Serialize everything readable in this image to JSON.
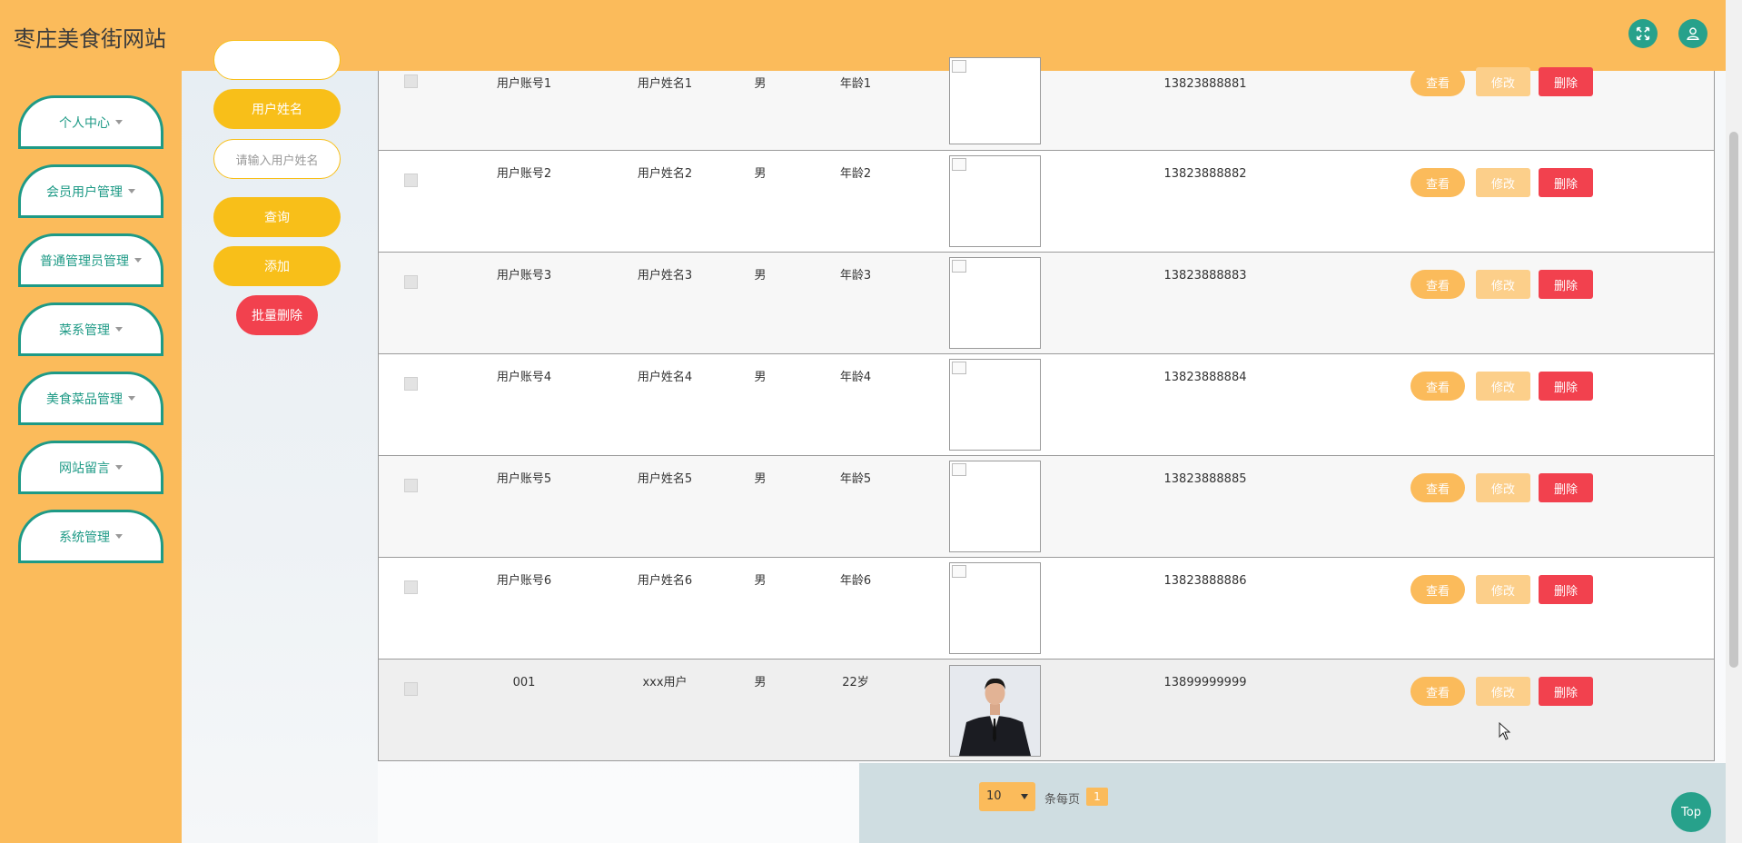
{
  "header": {
    "title": "枣庄美食街网站",
    "icons": [
      "fullscreen-icon",
      "user-icon"
    ],
    "accent": "#fbbb5b",
    "teal": "#27a18b"
  },
  "sidebar": {
    "items": [
      {
        "label": "个人中心"
      },
      {
        "label": "会员用户管理"
      },
      {
        "label": "普通管理员管理"
      },
      {
        "label": "菜系管理"
      },
      {
        "label": "美食菜品管理"
      },
      {
        "label": "网站留言"
      },
      {
        "label": "系统管理"
      }
    ]
  },
  "search": {
    "field_label": "用户姓名",
    "input_placeholder": "请输入用户姓名",
    "query_button": "查询",
    "add_button": "添加",
    "batch_delete_button": "批量删除"
  },
  "table": {
    "rows": [
      {
        "account": "用户账号1",
        "name": "用户姓名1",
        "gender": "男",
        "age": "年龄1",
        "phone": "13823888881",
        "has_photo": false
      },
      {
        "account": "用户账号2",
        "name": "用户姓名2",
        "gender": "男",
        "age": "年龄2",
        "phone": "13823888882",
        "has_photo": false
      },
      {
        "account": "用户账号3",
        "name": "用户姓名3",
        "gender": "男",
        "age": "年龄3",
        "phone": "13823888883",
        "has_photo": false
      },
      {
        "account": "用户账号4",
        "name": "用户姓名4",
        "gender": "男",
        "age": "年龄4",
        "phone": "13823888884",
        "has_photo": false
      },
      {
        "account": "用户账号5",
        "name": "用户姓名5",
        "gender": "男",
        "age": "年龄5",
        "phone": "13823888885",
        "has_photo": false
      },
      {
        "account": "用户账号6",
        "name": "用户姓名6",
        "gender": "男",
        "age": "年龄6",
        "phone": "13823888886",
        "has_photo": false
      },
      {
        "account": "001",
        "name": "xxx用户",
        "gender": "男",
        "age": "22岁",
        "phone": "13899999999",
        "has_photo": true
      }
    ],
    "actions": {
      "view": "查看",
      "edit": "修改",
      "delete": "删除"
    }
  },
  "pagination": {
    "page_size": "10",
    "per_page_label": "条每页",
    "current_page": "1"
  },
  "back_to_top": "Top"
}
